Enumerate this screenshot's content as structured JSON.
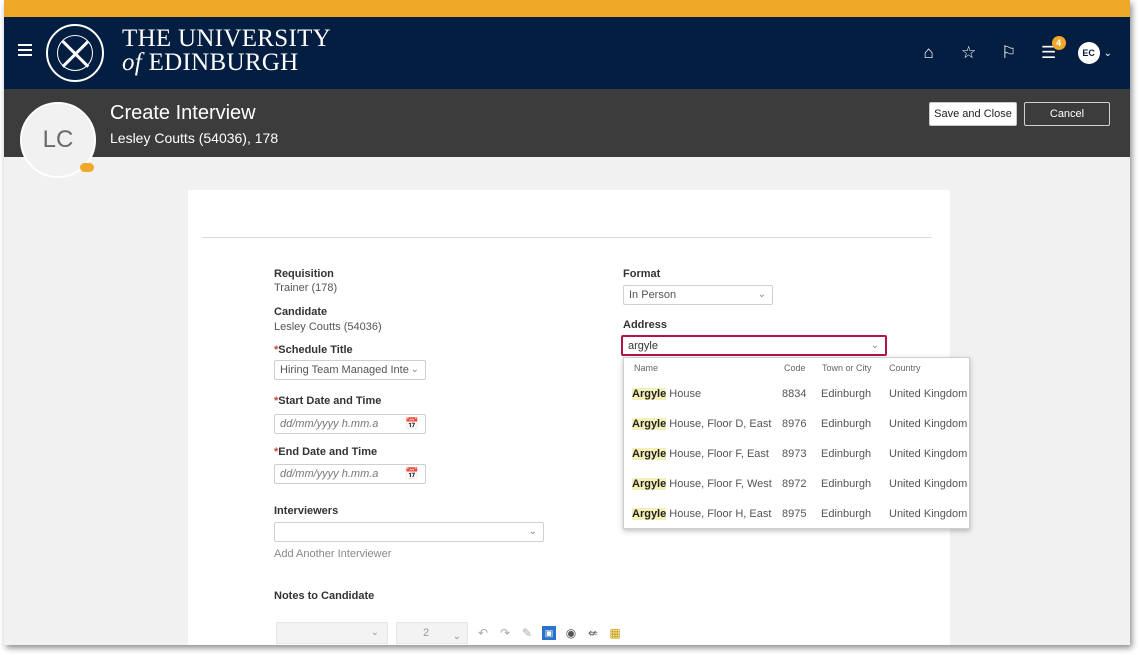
{
  "header": {
    "university_line1": "THE UNIVERSITY",
    "university_of": "of",
    "university_line2": "EDINBURGH",
    "notification_count": "4",
    "user_initials": "EC"
  },
  "titlebar": {
    "avatar_initials": "LC",
    "title": "Create Interview",
    "subtitle": "Lesley Coutts (54036), 178",
    "save_label": "Save and Close",
    "cancel_label": "Cancel"
  },
  "form": {
    "requisition_label": "Requisition",
    "requisition_value": "Trainer (178)",
    "candidate_label": "Candidate",
    "candidate_value": "Lesley Coutts (54036)",
    "schedule_title_label": "Schedule Title",
    "schedule_title_value": "Hiring Team Managed Inte",
    "start_label": "Start Date and Time",
    "start_placeholder": "dd/mm/yyyy h.mm.a",
    "end_label": "End Date and Time",
    "end_placeholder": "dd/mm/yyyy h.mm.a",
    "interviewers_label": "Interviewers",
    "interviewers_value": "",
    "add_interviewer": "Add Another Interviewer",
    "notes_label": "Notes to Candidate",
    "font_size_value": "2",
    "format_label": "Format",
    "format_value": "In Person",
    "address_label": "Address",
    "address_value": "argyle",
    "required_mark": "*"
  },
  "address_dropdown": {
    "columns": [
      "Name",
      "Code",
      "Town or City",
      "Country"
    ],
    "match": "Argyle",
    "rows": [
      {
        "name_rest": " House",
        "code": "8834",
        "town": "Edinburgh",
        "country": "United Kingdom"
      },
      {
        "name_rest": " House, Floor D, East",
        "code": "8976",
        "town": "Edinburgh",
        "country": "United Kingdom"
      },
      {
        "name_rest": " House, Floor F, East",
        "code": "8973",
        "town": "Edinburgh",
        "country": "United Kingdom"
      },
      {
        "name_rest": " House, Floor F, West",
        "code": "8972",
        "town": "Edinburgh",
        "country": "United Kingdom"
      },
      {
        "name_rest": " House, Floor H, East",
        "code": "8975",
        "town": "Edinburgh",
        "country": "United Kingdom"
      }
    ]
  },
  "colors": {
    "header_bg": "#041e42",
    "titlebar_bg": "#3c3c3c",
    "accent_orange": "#f0a829",
    "address_focus": "#b3134a"
  },
  "icons": [
    "hamburger-icon",
    "home-icon",
    "star-icon",
    "flag-icon",
    "notifications-icon",
    "chevron-down-icon",
    "calendar-icon",
    "undo-icon",
    "redo-icon",
    "pencil-icon"
  ]
}
